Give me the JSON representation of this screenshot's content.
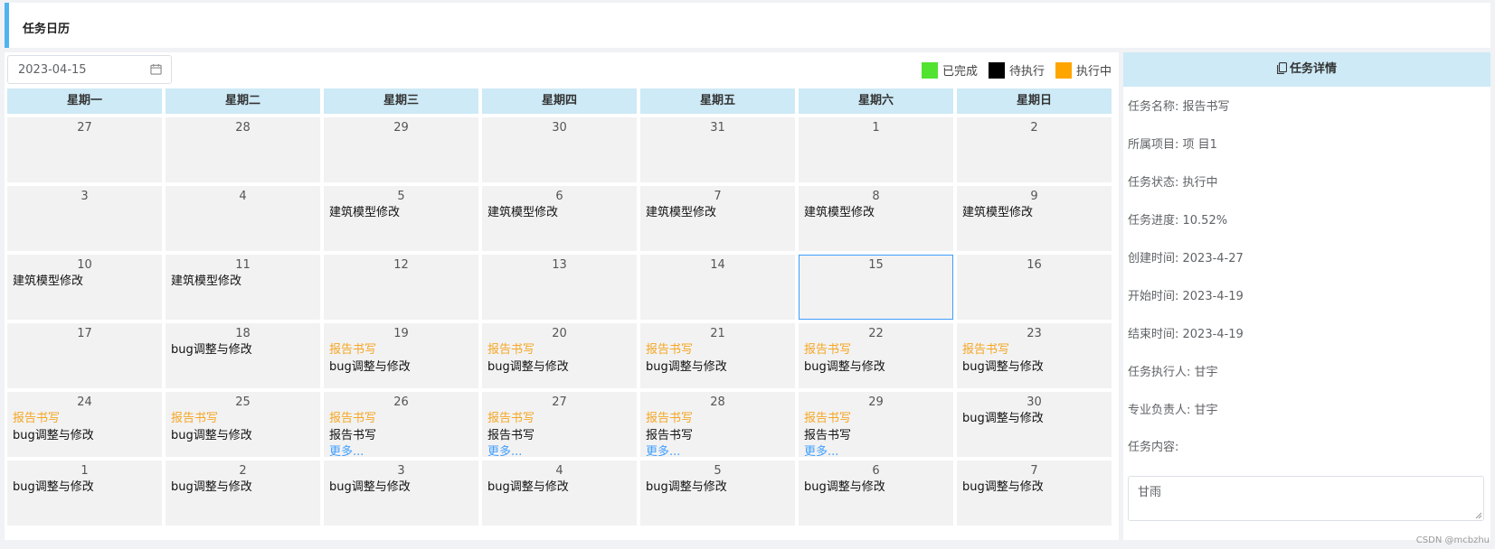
{
  "page": {
    "title": "任务日历"
  },
  "date_picker": {
    "value": "2023-04-15"
  },
  "legend": [
    {
      "label": "已完成",
      "color": "#52e230"
    },
    {
      "label": "待执行",
      "color": "#000000"
    },
    {
      "label": "执行中",
      "color": "#ffa500"
    }
  ],
  "weekdays": [
    "星期一",
    "星期二",
    "星期三",
    "星期四",
    "星期五",
    "星期六",
    "星期日"
  ],
  "weeks": [
    [
      {
        "day": "27",
        "tasks": []
      },
      {
        "day": "28",
        "tasks": []
      },
      {
        "day": "29",
        "tasks": []
      },
      {
        "day": "30",
        "tasks": []
      },
      {
        "day": "31",
        "tasks": []
      },
      {
        "day": "1",
        "tasks": []
      },
      {
        "day": "2",
        "tasks": []
      }
    ],
    [
      {
        "day": "3",
        "tasks": []
      },
      {
        "day": "4",
        "tasks": []
      },
      {
        "day": "5",
        "tasks": [
          {
            "text": "建筑模型修改",
            "status": "pending"
          }
        ]
      },
      {
        "day": "6",
        "tasks": [
          {
            "text": "建筑模型修改",
            "status": "pending"
          }
        ]
      },
      {
        "day": "7",
        "tasks": [
          {
            "text": "建筑模型修改",
            "status": "pending"
          }
        ]
      },
      {
        "day": "8",
        "tasks": [
          {
            "text": "建筑模型修改",
            "status": "pending"
          }
        ]
      },
      {
        "day": "9",
        "tasks": [
          {
            "text": "建筑模型修改",
            "status": "pending"
          }
        ]
      }
    ],
    [
      {
        "day": "10",
        "tasks": [
          {
            "text": "建筑模型修改",
            "status": "pending"
          }
        ]
      },
      {
        "day": "11",
        "tasks": [
          {
            "text": "建筑模型修改",
            "status": "pending"
          }
        ]
      },
      {
        "day": "12",
        "tasks": []
      },
      {
        "day": "13",
        "tasks": []
      },
      {
        "day": "14",
        "tasks": []
      },
      {
        "day": "15",
        "tasks": [],
        "selected": true
      },
      {
        "day": "16",
        "tasks": []
      }
    ],
    [
      {
        "day": "17",
        "tasks": []
      },
      {
        "day": "18",
        "tasks": [
          {
            "text": "bug调整与修改",
            "status": "pending"
          }
        ]
      },
      {
        "day": "19",
        "tasks": [
          {
            "text": "报告书写",
            "status": "running"
          },
          {
            "text": "bug调整与修改",
            "status": "pending"
          }
        ]
      },
      {
        "day": "20",
        "tasks": [
          {
            "text": "报告书写",
            "status": "running"
          },
          {
            "text": "bug调整与修改",
            "status": "pending"
          }
        ]
      },
      {
        "day": "21",
        "tasks": [
          {
            "text": "报告书写",
            "status": "running"
          },
          {
            "text": "bug调整与修改",
            "status": "pending"
          }
        ]
      },
      {
        "day": "22",
        "tasks": [
          {
            "text": "报告书写",
            "status": "running"
          },
          {
            "text": "bug调整与修改",
            "status": "pending"
          }
        ]
      },
      {
        "day": "23",
        "tasks": [
          {
            "text": "报告书写",
            "status": "running"
          },
          {
            "text": "bug调整与修改",
            "status": "pending"
          }
        ]
      }
    ],
    [
      {
        "day": "24",
        "tasks": [
          {
            "text": "报告书写",
            "status": "running"
          },
          {
            "text": "bug调整与修改",
            "status": "pending"
          }
        ]
      },
      {
        "day": "25",
        "tasks": [
          {
            "text": "报告书写",
            "status": "running"
          },
          {
            "text": "bug调整与修改",
            "status": "pending"
          }
        ]
      },
      {
        "day": "26",
        "tasks": [
          {
            "text": "报告书写",
            "status": "running"
          },
          {
            "text": "报告书写",
            "status": "pending"
          }
        ],
        "more": "更多..."
      },
      {
        "day": "27",
        "tasks": [
          {
            "text": "报告书写",
            "status": "running"
          },
          {
            "text": "报告书写",
            "status": "pending"
          }
        ],
        "more": "更多..."
      },
      {
        "day": "28",
        "tasks": [
          {
            "text": "报告书写",
            "status": "running"
          },
          {
            "text": "报告书写",
            "status": "pending"
          }
        ],
        "more": "更多..."
      },
      {
        "day": "29",
        "tasks": [
          {
            "text": "报告书写",
            "status": "running"
          },
          {
            "text": "报告书写",
            "status": "pending"
          }
        ],
        "more": "更多..."
      },
      {
        "day": "30",
        "tasks": [
          {
            "text": "bug调整与修改",
            "status": "pending"
          }
        ]
      }
    ],
    [
      {
        "day": "1",
        "tasks": [
          {
            "text": "bug调整与修改",
            "status": "pending"
          }
        ]
      },
      {
        "day": "2",
        "tasks": [
          {
            "text": "bug调整与修改",
            "status": "pending"
          }
        ]
      },
      {
        "day": "3",
        "tasks": [
          {
            "text": "bug调整与修改",
            "status": "pending"
          }
        ]
      },
      {
        "day": "4",
        "tasks": [
          {
            "text": "bug调整与修改",
            "status": "pending"
          }
        ]
      },
      {
        "day": "5",
        "tasks": [
          {
            "text": "bug调整与修改",
            "status": "pending"
          }
        ]
      },
      {
        "day": "6",
        "tasks": [
          {
            "text": "bug调整与修改",
            "status": "pending"
          }
        ]
      },
      {
        "day": "7",
        "tasks": [
          {
            "text": "bug调整与修改",
            "status": "pending"
          }
        ]
      }
    ]
  ],
  "details": {
    "title": "任务详情",
    "name": "任务名称: 报告书写",
    "project": "所属项目: 项 目1",
    "status": "任务状态: 执行中",
    "progress": "任务进度: 10.52%",
    "created": "创建时间: 2023-4-27",
    "start": "开始时间: 2023-4-19",
    "end": "结束时间: 2023-4-19",
    "executor": "任务执行人: 甘宇",
    "owner": "专业负责人: 甘宇",
    "content_label": "任务内容:",
    "content_value": "甘雨"
  },
  "watermark": "CSDN @mcbzhu",
  "colors": {
    "running": "#f5a623",
    "more": "#409eff",
    "header_bg": "#cdeaf6",
    "accent": "#4fb3f0"
  }
}
